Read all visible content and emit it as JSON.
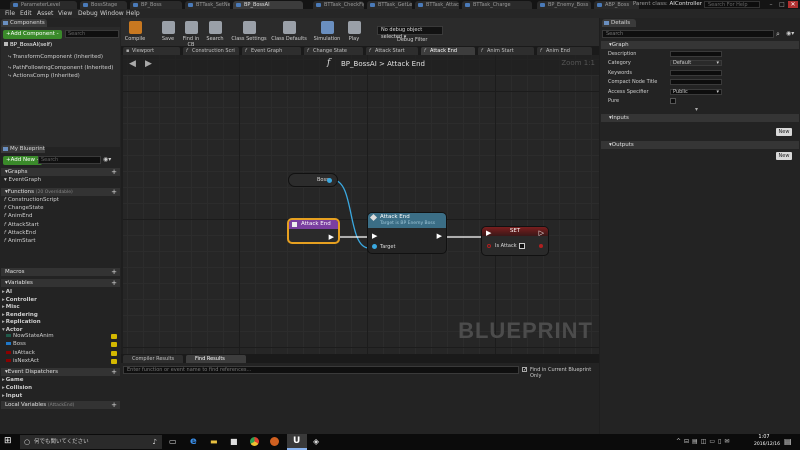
{
  "doc_tabs": [
    "ParameterLevel",
    "BossStage",
    "BP_Boss",
    "BTTask_SetNextAct",
    "BP_BossAI",
    "BTTask_CheckFig",
    "BTTask_GetLengthT",
    "BTTask_AttackNear",
    "BTTask_Charge",
    "BP_Enemy_Boss",
    "ABP_Boss"
  ],
  "active_doc_tab": 4,
  "parent_class": {
    "label": "Parent class:",
    "value": "AIController"
  },
  "search_help": "Search For Help",
  "menu": [
    "File",
    "Edit",
    "Asset",
    "View",
    "Debug",
    "Window",
    "Help"
  ],
  "components": {
    "tab_label": "Components",
    "add_button": "+Add Component -",
    "search_placeholder": "Search",
    "root": "BP_BossAI(self)",
    "items": [
      "TransformComponent (Inherited)",
      "PathFollowingComponent (Inherited)",
      "ActionsComp (Inherited)"
    ]
  },
  "my_blueprint": {
    "tab_label": "My Blueprint",
    "add_new": "+Add New -",
    "search_placeholder": "Search",
    "graphs_label": "Graphs",
    "graphs": [
      "EventGraph"
    ],
    "functions_label": "Functions",
    "functions_note": "(20 Overridable)",
    "functions": [
      "ConstructionScript",
      "ChangeState",
      "AnimEnd",
      "AttackStart",
      "AttackEnd",
      "AnimStart"
    ],
    "macros_label": "Macros",
    "variables_label": "Variables",
    "categories": [
      "AI",
      "Controller",
      "Misc",
      "Rendering",
      "Replication",
      "Actor"
    ],
    "variables": [
      {
        "name": "NowStateAnim",
        "color": "#1f5a4a"
      },
      {
        "name": "Boss",
        "color": "#1f78c8"
      },
      {
        "name": "isAttack",
        "color": "#8a0000"
      },
      {
        "name": "isNextAct",
        "color": "#8a0000"
      }
    ],
    "event_dispatchers_label": "Event Dispatchers",
    "dispatcher_categories": [
      "Game",
      "Collision",
      "Input"
    ],
    "local_vars_label": "Local Variables",
    "local_vars_note": "(AttackEnd)"
  },
  "toolbar": [
    {
      "label": "Compile",
      "color": "#c87820"
    },
    {
      "label": "Save",
      "color": "#9aa0a8"
    },
    {
      "label": "Find in CB",
      "color": "#9aa0a8"
    },
    {
      "label": "Search",
      "color": "#9aa0a8"
    },
    {
      "label": "Class Settings",
      "color": "#9aa0a8"
    },
    {
      "label": "Class Defaults",
      "color": "#9aa0a8"
    },
    {
      "label": "Simulation",
      "color": "#6a8fc0"
    },
    {
      "label": "Play",
      "color": "#9aa0a8"
    }
  ],
  "debug": {
    "selected": "No debug object selected",
    "label": "Debug Filter"
  },
  "graph_tabs": [
    "Viewport",
    "Construction Scri",
    "Event Graph",
    "Change State",
    "Attack Start",
    "Attack End",
    "Anim Start",
    "Anim End"
  ],
  "active_graph_tab": 5,
  "breadcrumb": {
    "func_glyph": "f",
    "path": "BP_BossAI > Attack End"
  },
  "zoom": "Zoom 1:1",
  "watermark": "BLUEPRINT",
  "nodes": {
    "boss_getter": "Boss",
    "entry": "Attack End",
    "call_title": "Attack End",
    "call_subtitle": "Target is BP Enemy Boss",
    "call_pin": "Target",
    "set_title": "SET",
    "set_pin": "Is Attack"
  },
  "bottom": {
    "tabs": [
      "Compiler Results",
      "Find Results"
    ],
    "search_placeholder": "Enter function or event name to find references...",
    "find_current_label": "Find in Current Blueprint Only"
  },
  "details": {
    "tab_label": "Details",
    "search_placeholder": "Search",
    "graph_label": "Graph",
    "rows": [
      {
        "label": "Description",
        "value": ""
      },
      {
        "label": "Category",
        "value": "Default"
      },
      {
        "label": "Keywords",
        "value": ""
      },
      {
        "label": "Compact Node Title",
        "value": ""
      },
      {
        "label": "Access Specifier",
        "value": "Public"
      },
      {
        "label": "Pure",
        "value": ""
      }
    ],
    "inputs_label": "Inputs",
    "outputs_label": "Outputs",
    "new_button": "New"
  },
  "taskbar": {
    "search_placeholder": "何でも聞いてください",
    "time": "1:07",
    "date": "2016/12/16"
  }
}
